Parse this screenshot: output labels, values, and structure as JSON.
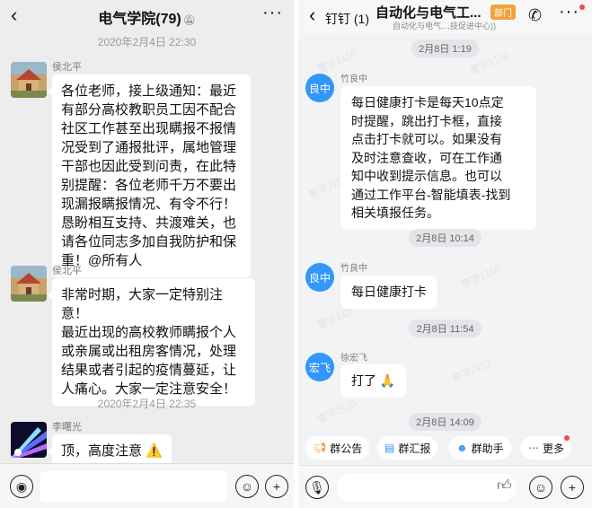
{
  "wechat": {
    "title": "电气学院(79)",
    "mute_icon": "bell-slash-icon",
    "timestamps": [
      "2020年2月4日 22:30",
      "2020年2月4日 22:35"
    ],
    "messages": [
      {
        "sender": "侯北平",
        "text": "各位老师，接上级通知：最近\n有部分高校教职员工因不配合\n社区工作甚至出现瞒报不报情\n况受到了通报批评，属地管理\n干部也因此受到问责，在此特\n别提醒：各位老师千万不要出\n现漏报瞒报情况、有令不行！\n恳盼相互支持、共渡难关，也\n请各位同志多加自我防护和保\n重！@所有人"
      },
      {
        "sender": "侯北平",
        "text": "非常时期，大家一定特别注意！\n最近出现的高校教师瞒报个人\n或亲属或出租房客情况，处理\n结果或者引起的疫情蔓延，让\n人痛心。大家一定注意安全！"
      },
      {
        "sender": "李曙光",
        "text": "顶，高度注意 ⚠️"
      }
    ]
  },
  "dingtalk": {
    "back_label": "钉钉 (1)",
    "title": "自动化与电气工...",
    "badge": "部门",
    "subtitle": "自动化与电气...,技促进中心))",
    "timestamps": [
      "2月8日 1:19",
      "2月8日 10:14",
      "2月8日 11:54",
      "2月8日 14:09"
    ],
    "messages": [
      {
        "sender": "竹良中",
        "avatar_text": "良中",
        "text": "每日健康打卡是每天10点定\n时提醒，跳出打卡框，直接\n点击打卡就可以。如果没有\n及时注意查收，可在工作通\n知中收到提示信息。也可以\n通过工作平台-智能填表-找到\n相关填报任务。"
      },
      {
        "sender": "竹良中",
        "avatar_text": "良中",
        "text": "每日健康打卡"
      },
      {
        "sender": "徐宏飞",
        "avatar_text": "宏飞",
        "text": "打了 🙏"
      }
    ],
    "watermark": "曹宇2110",
    "quick_actions": [
      {
        "label": "群公告",
        "icon": "megaphone-icon"
      },
      {
        "label": "群汇报",
        "icon": "report-icon"
      },
      {
        "label": "群助手",
        "icon": "assistant-icon"
      },
      {
        "label": "更多",
        "icon": "more-dots-icon"
      }
    ]
  },
  "colors": {
    "wechat_bg": "#ededed",
    "dingtalk_bg": "#f2f3f5",
    "dingtalk_avatar": "#3296fa",
    "badge": "#f0a33c",
    "notification_dot": "#f54a45"
  }
}
